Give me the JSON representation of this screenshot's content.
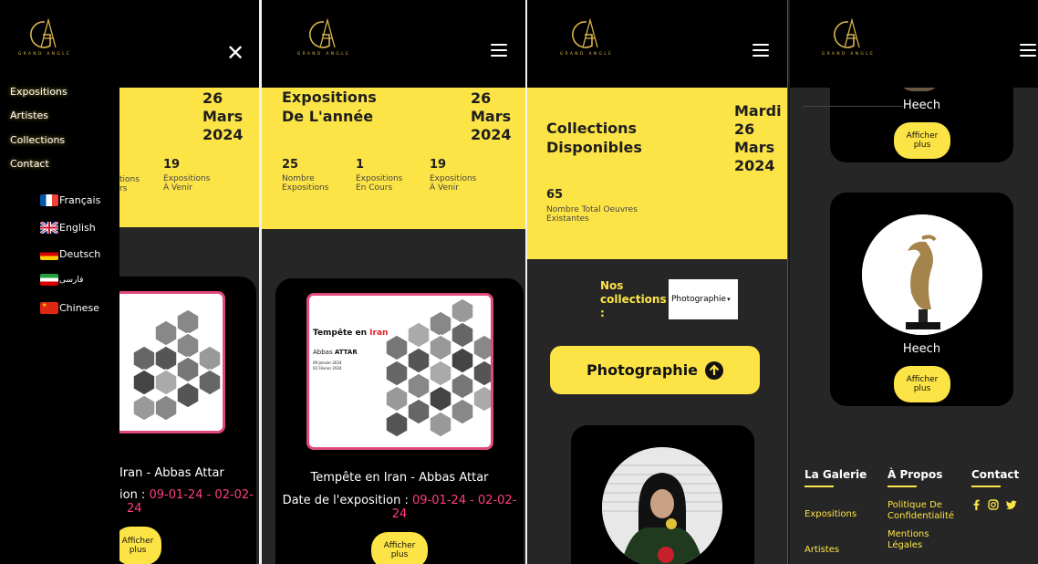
{
  "brand": {
    "logo_letters": "GA",
    "logo_sub": "GRAND ANGLE"
  },
  "menu": {
    "links": [
      "Expositions",
      "Artistes",
      "Collections",
      "Contact"
    ],
    "languages": [
      "Français",
      "English",
      "Deutsch",
      "فارسی",
      "Chinese"
    ],
    "close_icon": "✕"
  },
  "expositions": {
    "title_line1": "Expositions",
    "title_line2": "De L'année",
    "date_line1": "26",
    "date_line2": "Mars",
    "date_line3": "2024",
    "stats": [
      {
        "num": "25",
        "label1": "Nombre",
        "label2": "Expositions"
      },
      {
        "num": "1",
        "label1": "Expositions",
        "label2": "En Cours"
      },
      {
        "num": "19",
        "label1": "Expositions",
        "label2": "À Venir"
      }
    ],
    "partial_stat_label1": "tions",
    "partial_stat_label2": "rs",
    "card": {
      "poster_title": "Tempête en",
      "poster_title_red": "Iran",
      "poster_artist_pre": "Abbas",
      "poster_artist": "ATTAR",
      "poster_date1": "09 Janvier 2024",
      "poster_date2": "02 Février 2024",
      "caption": "Tempête en Iran - Abbas Attar",
      "caption_partial": "Iran - Abbas Attar",
      "date_label": "Date de l'exposition :",
      "date_label_partial": "ion :",
      "date_value1": "09-01-24 - 02-02-",
      "date_value2": "24",
      "button_line1": "Afficher",
      "button_line2": "plus"
    }
  },
  "collections": {
    "title_line1": "Collections",
    "title_line2": "Disponibles",
    "date_line1": "Mardi",
    "date_line2": "26",
    "date_line3": "Mars",
    "date_line4": "2024",
    "total_num": "65",
    "total_label1": "Nombre Total Oeuvres",
    "total_label2": "Existantes",
    "select_label1": "Nos",
    "select_label2": "collections",
    "select_label3": ":",
    "select_value": "Photographie",
    "category_button": "Photographie"
  },
  "artworks": [
    {
      "name": "Heech",
      "button_line1": "Afficher",
      "button_line2": "plus"
    },
    {
      "name": "Heech",
      "button_line1": "Afficher",
      "button_line2": "plus"
    }
  ],
  "footer": {
    "col1_title": "La Galerie",
    "col1_links": [
      "Expositions",
      "Artistes"
    ],
    "col2_title": "À Propos",
    "col2_link1a": "Politique De",
    "col2_link1b": "Confidentialité",
    "col2_link2a": "Mentions",
    "col2_link2b": "Légales",
    "col3_title": "Contact",
    "social_icons": [
      "facebook-icon",
      "instagram-icon",
      "twitter-icon"
    ]
  },
  "colors": {
    "accent": "#fde446",
    "pink": "#ff3e7a",
    "background": "#262626",
    "header": "#000000"
  }
}
